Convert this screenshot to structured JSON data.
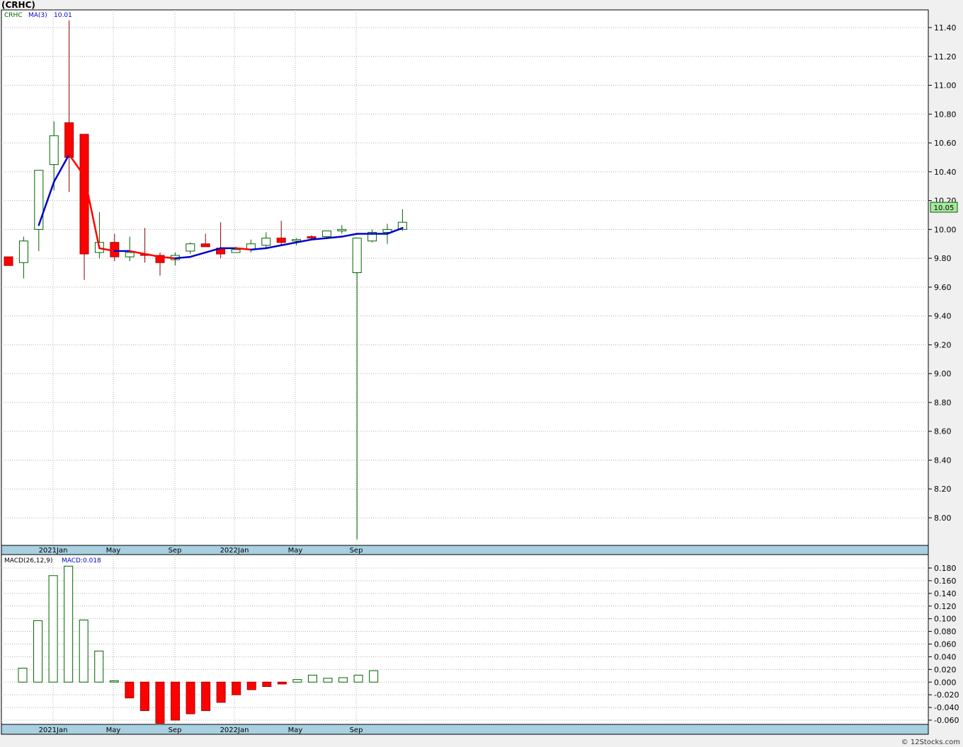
{
  "header": {
    "title": "(CRHC)"
  },
  "footer": {
    "credit": "© 12Stocks.com"
  },
  "colors": {
    "up": "#ffffff",
    "upBorder": "#006400",
    "down": "#ff0000",
    "wick": "#006400",
    "maUp": "#0000cc",
    "maDown": "#ff0000",
    "axisBar": "#a8d0e0"
  },
  "chart_data": [
    {
      "type": "candlestick",
      "legend": {
        "symbol": "CRHC",
        "ma_label": "MA(3)",
        "ma_value": "10.01"
      },
      "last_price_label": "10.05",
      "ylim": [
        7.85,
        11.5
      ],
      "yticks": [
        "11.40",
        "11.20",
        "11.00",
        "10.80",
        "10.60",
        "10.40",
        "10.20",
        "10.00",
        "9.80",
        "9.60",
        "9.40",
        "9.20",
        "9.00",
        "8.80",
        "8.60",
        "8.40",
        "8.20",
        "8.00"
      ],
      "xlabels": [
        "2021Jan",
        "May",
        "Sep",
        "2022Jan",
        "May",
        "Sep"
      ],
      "grid": true,
      "candles": [
        {
          "o": 9.81,
          "h": 9.81,
          "l": 9.75,
          "c": 9.75
        },
        {
          "o": 9.77,
          "h": 9.95,
          "l": 9.66,
          "c": 9.92
        },
        {
          "o": 10.0,
          "h": 10.3,
          "l": 9.85,
          "c": 10.41
        },
        {
          "o": 10.45,
          "h": 10.75,
          "l": 10.27,
          "c": 10.65
        },
        {
          "o": 10.74,
          "h": 11.45,
          "l": 10.26,
          "c": 10.5
        },
        {
          "o": 10.66,
          "h": 10.66,
          "l": 9.65,
          "c": 9.83
        },
        {
          "o": 9.84,
          "h": 10.12,
          "l": 9.8,
          "c": 9.91
        },
        {
          "o": 9.91,
          "h": 9.97,
          "l": 9.78,
          "c": 9.81
        },
        {
          "o": 9.81,
          "h": 9.95,
          "l": 9.78,
          "c": 9.84
        },
        {
          "o": 9.83,
          "h": 10.01,
          "l": 9.77,
          "c": 9.82
        },
        {
          "o": 9.82,
          "h": 9.84,
          "l": 9.68,
          "c": 9.77
        },
        {
          "o": 9.79,
          "h": 9.84,
          "l": 9.75,
          "c": 9.82
        },
        {
          "o": 9.85,
          "h": 9.91,
          "l": 9.83,
          "c": 9.9
        },
        {
          "o": 9.9,
          "h": 9.97,
          "l": 9.88,
          "c": 9.88
        },
        {
          "o": 9.87,
          "h": 10.05,
          "l": 9.8,
          "c": 9.83
        },
        {
          "o": 9.84,
          "h": 9.88,
          "l": 9.84,
          "c": 9.86
        },
        {
          "o": 9.86,
          "h": 9.93,
          "l": 9.84,
          "c": 9.9
        },
        {
          "o": 9.89,
          "h": 9.98,
          "l": 9.87,
          "c": 9.94
        },
        {
          "o": 9.94,
          "h": 10.06,
          "l": 9.89,
          "c": 9.91
        },
        {
          "o": 9.92,
          "h": 9.94,
          "l": 9.89,
          "c": 9.93
        },
        {
          "o": 9.95,
          "h": 9.96,
          "l": 9.93,
          "c": 9.94
        },
        {
          "o": 9.95,
          "h": 9.99,
          "l": 9.94,
          "c": 9.99
        },
        {
          "o": 9.99,
          "h": 10.03,
          "l": 9.97,
          "c": 10.0
        },
        {
          "o": 9.7,
          "h": 9.94,
          "l": 7.85,
          "c": 9.94
        },
        {
          "o": 9.92,
          "h": 10.0,
          "l": 9.91,
          "c": 9.98
        },
        {
          "o": 9.98,
          "h": 10.04,
          "l": 9.9,
          "c": 10.0
        },
        {
          "o": 10.0,
          "h": 10.14,
          "l": 9.99,
          "c": 10.05
        }
      ],
      "ma": [
        null,
        null,
        10.03,
        10.33,
        10.52,
        10.37,
        9.87,
        9.85,
        9.85,
        9.83,
        9.81,
        9.8,
        9.81,
        9.84,
        9.87,
        9.87,
        9.86,
        9.87,
        9.89,
        9.91,
        9.93,
        9.94,
        9.95,
        9.97,
        9.97,
        9.97,
        10.01
      ]
    },
    {
      "type": "bar",
      "legend": {
        "name": "MACD(26,12,9)",
        "value_label": "MACD:0.018"
      },
      "ylim": [
        -0.068,
        0.188
      ],
      "yticks": [
        "0.180",
        "0.160",
        "0.140",
        "0.120",
        "0.100",
        "0.080",
        "0.060",
        "0.040",
        "0.020",
        "0.000",
        "-0.020",
        "-0.040",
        "-0.060"
      ],
      "xlabels": [
        "2021Jan",
        "May",
        "Sep",
        "2022Jan",
        "May",
        "Sep"
      ],
      "values": [
        0.022,
        0.097,
        0.168,
        0.183,
        0.098,
        0.049,
        0.002,
        -0.025,
        -0.045,
        -0.065,
        -0.06,
        -0.05,
        -0.045,
        -0.032,
        -0.02,
        -0.012,
        -0.007,
        -0.003,
        0.004,
        0.011,
        0.006,
        0.007,
        0.011,
        0.018
      ]
    }
  ]
}
